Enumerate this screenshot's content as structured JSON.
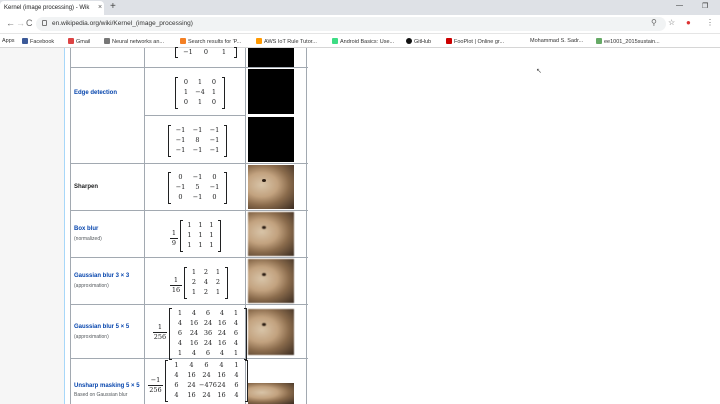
{
  "browser": {
    "tab_title": "Kernel (image processing) - Wik",
    "tab_close": "×",
    "new_tab": "+",
    "win_min": "—",
    "win_max": "❐",
    "url": "en.wikipedia.org/wiki/Kernel_(image_processing)",
    "back": "←",
    "forward": "→",
    "reload": "C",
    "bookmarks": [
      "Apps",
      "Facebook",
      "Gmail",
      "Neural networks an...",
      "Search results for 'P...",
      "AWS IoT Rule Tutor...",
      "Android Basics: Use...",
      "GitHub",
      "FooPlot | Online gr...",
      "Mohammad S. Sadr...",
      "ee1001_2015sustain..."
    ]
  },
  "table": {
    "rows": [
      {
        "label": "Edge detection",
        "link": true
      },
      {
        "label": "Sharpen",
        "link": false
      },
      {
        "label": "Box blur",
        "link": true,
        "note": "(normalized)"
      },
      {
        "label": "Gaussian blur 3 × 3",
        "link": true,
        "note": "(approximation)"
      },
      {
        "label": "Gaussian blur 5 × 5",
        "link": true,
        "note": "(approximation)"
      },
      {
        "label": "Unsharp masking 5 × 5",
        "link": true,
        "note": "Based on Gaussian blur"
      }
    ],
    "matrices": {
      "top_partial": [
        [
          "−1",
          "0",
          "1"
        ]
      ],
      "edge2": [
        [
          "0",
          "1",
          "0"
        ],
        [
          "1",
          "−4",
          "1"
        ],
        [
          "0",
          "1",
          "0"
        ]
      ],
      "edge3": [
        [
          "−1",
          "−1",
          "−1"
        ],
        [
          "−1",
          "8",
          "−1"
        ],
        [
          "−1",
          "−1",
          "−1"
        ]
      ],
      "sharpen": [
        [
          "0",
          "−1",
          "0"
        ],
        [
          "−1",
          "5",
          "−1"
        ],
        [
          "0",
          "−1",
          "0"
        ]
      ],
      "box": [
        [
          "1",
          "1",
          "1"
        ],
        [
          "1",
          "1",
          "1"
        ],
        [
          "1",
          "1",
          "1"
        ]
      ],
      "gauss3": [
        [
          "1",
          "2",
          "1"
        ],
        [
          "2",
          "4",
          "2"
        ],
        [
          "1",
          "2",
          "1"
        ]
      ],
      "gauss5": [
        [
          "1",
          "4",
          "6",
          "4",
          "1"
        ],
        [
          "4",
          "16",
          "24",
          "16",
          "4"
        ],
        [
          "6",
          "24",
          "36",
          "24",
          "6"
        ],
        [
          "4",
          "16",
          "24",
          "16",
          "4"
        ],
        [
          "1",
          "4",
          "6",
          "4",
          "1"
        ]
      ],
      "unsharp": [
        [
          "1",
          "4",
          "6",
          "4",
          "1"
        ],
        [
          "4",
          "16",
          "24",
          "16",
          "4"
        ],
        [
          "6",
          "24",
          "−476",
          "24",
          "6"
        ],
        [
          "4",
          "16",
          "24",
          "16",
          "4"
        ]
      ]
    },
    "fractions": {
      "box": {
        "num": "1",
        "den": "9"
      },
      "gauss3": {
        "num": "1",
        "den": "16"
      },
      "gauss5": {
        "num": "1",
        "den": "256"
      },
      "unsharp": {
        "num": "−1",
        "den": "256"
      }
    }
  },
  "colors": {
    "link": "#0645ad",
    "border": "#a2a9b1"
  }
}
